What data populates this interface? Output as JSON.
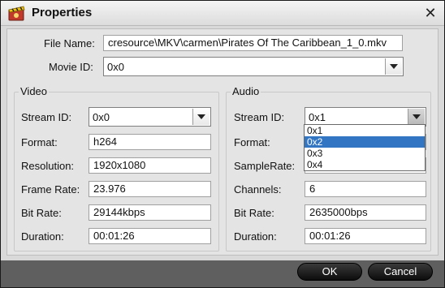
{
  "window": {
    "title": "Properties",
    "close_glyph": "✕"
  },
  "general": {
    "file_name_label": "File Name:",
    "file_name_value": "cresource\\MKV\\carmen\\Pirates Of The Caribbean_1_0.mkv",
    "movie_id_label": "Movie ID:",
    "movie_id_value": "0x0"
  },
  "video": {
    "group_title": "Video",
    "stream_id_label": "Stream ID:",
    "stream_id_value": "0x0",
    "format_label": "Format:",
    "format_value": "h264",
    "resolution_label": "Resolution:",
    "resolution_value": "1920x1080",
    "frame_rate_label": "Frame Rate:",
    "frame_rate_value": "23.976",
    "bit_rate_label": "Bit Rate:",
    "bit_rate_value": "29144kbps",
    "duration_label": "Duration:",
    "duration_value": "00:01:26"
  },
  "audio": {
    "group_title": "Audio",
    "stream_id_label": "Stream ID:",
    "stream_id_value": "0x1",
    "stream_id_options": [
      "0x1",
      "0x2",
      "0x3",
      "0x4"
    ],
    "stream_id_highlighted": "0x2",
    "format_label": "Format:",
    "samplerate_label": "SampleRate:",
    "channels_label": "Channels:",
    "channels_value": "6",
    "bit_rate_label": "Bit Rate:",
    "bit_rate_value": "2635000bps",
    "duration_label": "Duration:",
    "duration_value": "00:01:26"
  },
  "footer": {
    "ok_label": "OK",
    "cancel_label": "Cancel"
  },
  "colors": {
    "selection": "#3276c3",
    "footer_bg": "#5f5f5f",
    "button_bg": "#111111"
  },
  "icons": {
    "app": "film-clapper-icon",
    "close": "close-icon",
    "dropdown": "chevron-down-icon"
  }
}
